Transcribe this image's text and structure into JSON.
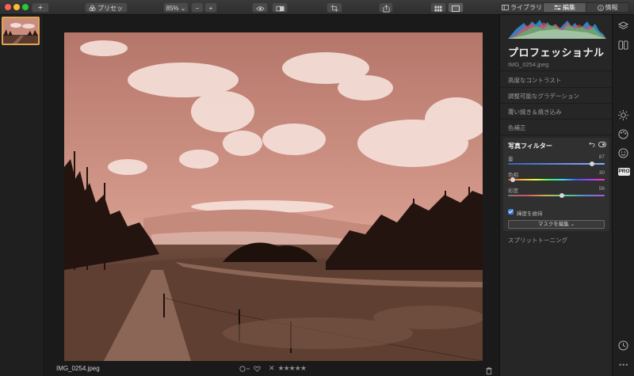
{
  "toolbar": {
    "add_label": "+",
    "preset_label": "プリセット",
    "zoom_label": "85% ⌄",
    "zoom_minus": "−",
    "zoom_plus": "+"
  },
  "tabs": [
    {
      "label": "ライブラリ",
      "icon": "library-icon",
      "active": false
    },
    {
      "label": "編集",
      "icon": "sliders-icon",
      "active": true
    },
    {
      "label": "情報",
      "icon": "info-icon",
      "active": false
    }
  ],
  "image": {
    "file_name": "IMG_0254.jpeg"
  },
  "footer": {
    "file_name": "IMG_0254.jpeg",
    "reject": "✕",
    "stars": "★★★★★"
  },
  "panel": {
    "title": "プロフェッショナル",
    "file_name": "IMG_0254.jpeg",
    "sections": [
      "高度なコントラスト",
      "調整可能なグラデーション",
      "覆い焼き＆焼き込み",
      "色補正"
    ],
    "filter": {
      "title": "写真フィルター",
      "sliders": [
        {
          "label": "量",
          "value": 87
        },
        {
          "label": "色相",
          "value": 30
        },
        {
          "label": "彩度",
          "value": 56
        }
      ],
      "checkbox_label": "輝度を維持",
      "checkbox_checked": true,
      "mask_button": "マスクを編集 ⌄"
    },
    "split_toning": "スプリットトーニング"
  },
  "colors": {
    "accent": "#e0a454",
    "checkbox": "#3d7fd6",
    "panel_bg": "#262626"
  }
}
